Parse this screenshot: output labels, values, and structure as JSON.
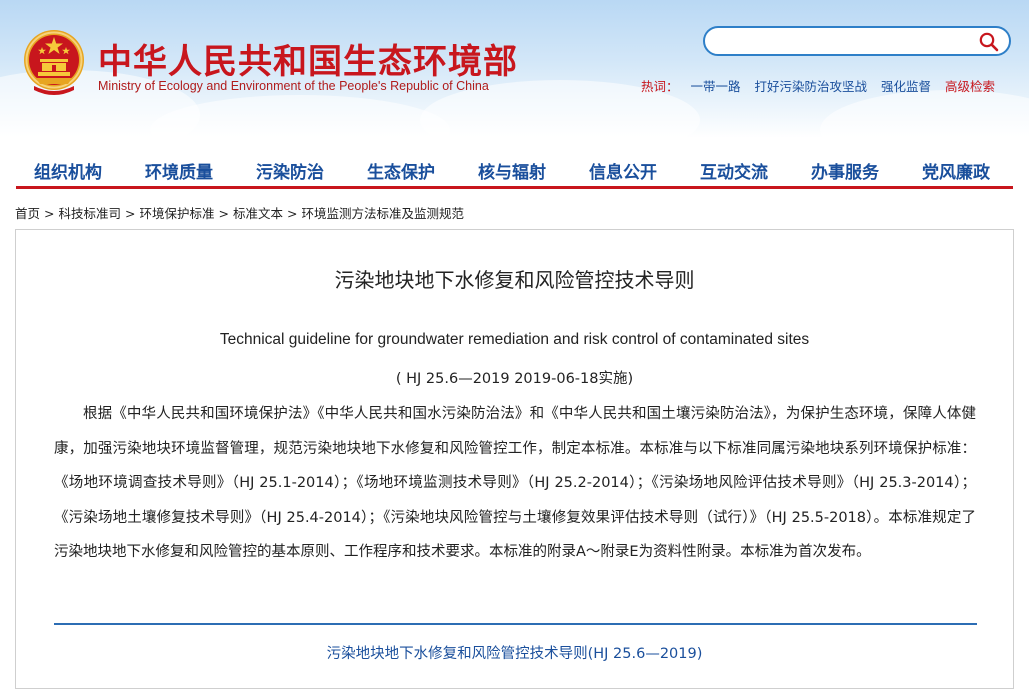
{
  "header": {
    "site_name_cn": "中华人民共和国生态环境部",
    "site_name_en": "Ministry of Ecology and Environment of the People's Republic of China",
    "emblem_icon": "national-emblem-icon",
    "search": {
      "placeholder": "",
      "icon": "search-icon"
    },
    "hot": {
      "label": "热词：",
      "links": [
        "一带一路",
        "打好污染防治攻坚战",
        "强化监督",
        "高级检索"
      ]
    },
    "colors": {
      "brand_red": "#c8161d",
      "nav_blue": "#1a4f9c",
      "accent_blue": "#2e7fc8"
    }
  },
  "nav": {
    "items": [
      "组织机构",
      "环境质量",
      "污染防治",
      "生态保护",
      "核与辐射",
      "信息公开",
      "互动交流",
      "办事服务",
      "党风廉政"
    ]
  },
  "breadcrumb": {
    "items": [
      "首页",
      "科技标准司",
      "环境保护标准",
      "标准文本",
      "环境监测方法标准及监测规范"
    ],
    "separator": ">"
  },
  "document": {
    "title_cn": "污染地块地下水修复和风险管控技术导则",
    "title_en": "Technical guideline for groundwater remediation and risk control of contaminated sites",
    "code": "( HJ 25.6—2019 2019-06-18实施)",
    "body": "根据《中华人民共和国环境保护法》《中华人民共和国水污染防治法》和《中华人民共和国土壤污染防治法》，为保护生态环境，保障人体健康，加强污染地块环境监督管理，规范污染地块地下水修复和风险管控工作，制定本标准。本标准与以下标准同属污染地块系列环境保护标准：《场地环境调查技术导则》（HJ 25.1-2014）；《场地环境监测技术导则》（HJ 25.2-2014）；《污染场地风险评估技术导则》（HJ 25.3-2014）；《污染场地土壤修复技术导则》（HJ 25.4-2014）；《污染地块风险管控与土壤修复效果评估技术导则（试行）》（HJ 25.5-2018）。本标准规定了污染地块地下水修复和风险管控的基本原则、工作程序和技术要求。本标准的附录A～附录E为资料性附录。本标准为首次发布。",
    "attachment_link": "污染地块地下水修复和风险管控技术导则(HJ 25.6—2019)"
  }
}
